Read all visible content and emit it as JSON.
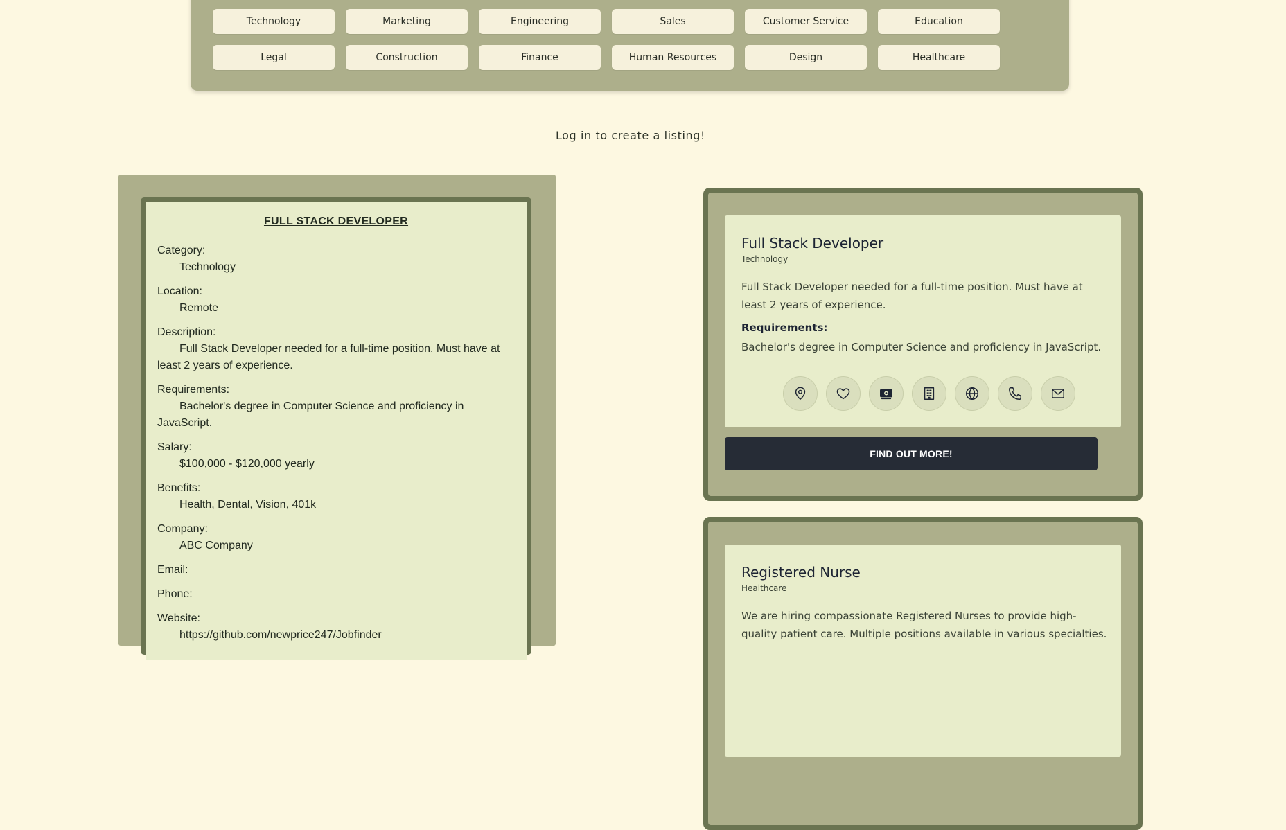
{
  "categories": {
    "row1": [
      "Technology",
      "Marketing",
      "Engineering",
      "Sales",
      "Customer Service",
      "Education"
    ],
    "row2": [
      "Legal",
      "Construction",
      "Finance",
      "Human Resources",
      "Design",
      "Healthcare"
    ]
  },
  "login_message": "Log in to create a listing!",
  "detail": {
    "title": "FULL STACK DEVELOPER",
    "fields": [
      {
        "label": "Category:",
        "value": "Technology"
      },
      {
        "label": "Location:",
        "value": "Remote"
      },
      {
        "label": "Description:",
        "value": "Full Stack Developer needed for a full-time position. Must have at least 2 years of experience."
      },
      {
        "label": "Requirements:",
        "value": "Bachelor's degree in Computer Science and proficiency in JavaScript."
      },
      {
        "label": "Salary:",
        "value": "$100,000 - $120,000 yearly"
      },
      {
        "label": "Benefits:",
        "value": "Health, Dental, Vision, 401k"
      },
      {
        "label": "Company:",
        "value": "ABC Company"
      },
      {
        "label": "Email:",
        "value": ""
      },
      {
        "label": "Phone:",
        "value": ""
      },
      {
        "label": "Website:",
        "value": "https://github.com/newprice247/Jobfinder"
      }
    ]
  },
  "listings": [
    {
      "title": "Full Stack Developer",
      "category": "Technology",
      "description": "Full Stack Developer needed for a full-time position. Must have at least 2 years of experience.",
      "requirements_label": "Requirements:",
      "requirements": "Bachelor's degree in Computer Science and proficiency in JavaScript.",
      "icons": [
        "location-icon",
        "heart-icon",
        "money-icon",
        "building-icon",
        "globe-icon",
        "phone-icon",
        "email-icon"
      ],
      "button_label": "FIND OUT MORE!"
    },
    {
      "title": "Registered Nurse",
      "category": "Healthcare",
      "description": "We are hiring compassionate Registered Nurses to provide high-quality patient care. Multiple positions available in various specialties."
    }
  ]
}
